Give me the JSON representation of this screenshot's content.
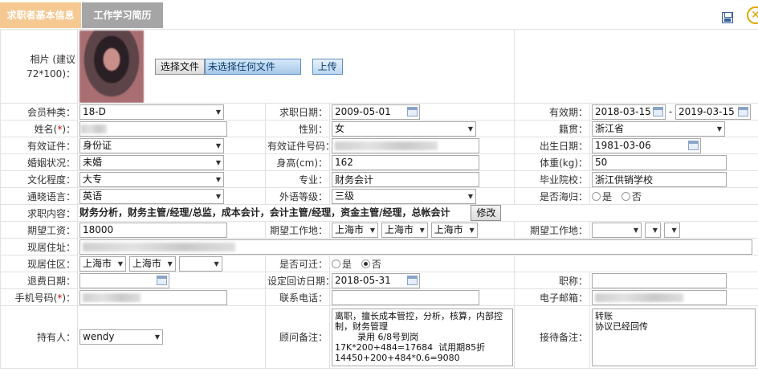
{
  "tabs": [
    {
      "label": "求职者基本信息"
    },
    {
      "label": "工作学习简历"
    }
  ],
  "form": {
    "photo_label": "相片 (建议72*100)：",
    "choose_file_label": "选择文件",
    "no_file_label": "未选择任何文件",
    "upload_label": "上传",
    "member_type_label": "会员种类：",
    "member_type": "18-D",
    "job_date_label": "求职日期：",
    "job_date": "2009-05-01",
    "valid_label": "有效期：",
    "valid_from": "2018-03-15",
    "valid_sep": "-",
    "valid_to": "2019-03-15",
    "name_label": "姓名(",
    "name_req": "*",
    "name_label_end": ")：",
    "gender_label": "性别：",
    "gender": "女",
    "hometown_label": "籍贯：",
    "hometown": "浙江省",
    "id_type_label": "有效证件：",
    "id_type": "身份证",
    "id_no_label": "有效证件号码：",
    "birth_label": "出生日期：",
    "birth": "1981-03-06",
    "marital_label": "婚姻状况：",
    "marital": "未婚",
    "height_label": "身高(cm)：",
    "height": "162",
    "weight_label": "体重(kg)：",
    "weight": "50",
    "edu_label": "文化程度：",
    "edu": "大专",
    "major_label": "专业：",
    "major": "财务会计",
    "school_label": "毕业院校：",
    "school": "浙江供销学校",
    "lang_label": "通晓语言：",
    "lang": "英语",
    "lang_level_label": "外语等级：",
    "lang_level": "三级",
    "overseas_label": "是否海归：",
    "yes": "是",
    "no": "否",
    "job_content_label": "求职内容：",
    "job_content": "财务分析，财务主管/经理/总监，成本会计，会计主管/经理，资金主管/经理，总帐会计",
    "modify_label": "修改",
    "salary_label": "期望工资：",
    "salary": "18000",
    "workplace_label": "期望工作地：",
    "workplace_1": "上海市",
    "workplace_2": "上海市",
    "workplace_3": "上海市",
    "workplace2_label": "期望工作地：",
    "address_label": "现居住址：",
    "district_label": "现居住区：",
    "district_1": "上海市",
    "district_2": "上海市",
    "relocate_label": "是否可迁：",
    "retire_label": "退费日期：",
    "visit_label": "设定回访日期：",
    "visit_date": "2018-05-31",
    "title_label": "职称：",
    "phone_label": "手机号码(",
    "phone_req": "*",
    "phone_label_end": ")：",
    "contact_label": "联系电话：",
    "email_label": "电子邮箱：",
    "holder_label": "持有人：",
    "holder": "wendy",
    "advisor_note_label": "顾问备注：",
    "advisor_note": "离职，擅长成本管控，分析，核算，内部控制，财务管理\n        录用 6/8号到岗\n17K*200+484=17684  试用期85折\n14450+200+484*0.6=9080",
    "reception_note_label": "接待备注：",
    "reception_note": "转账\n协议已经回传"
  },
  "colors": {
    "active_tab": "#f6c892",
    "inactive_tab": "#a5a5a5",
    "required": "#d40000"
  }
}
